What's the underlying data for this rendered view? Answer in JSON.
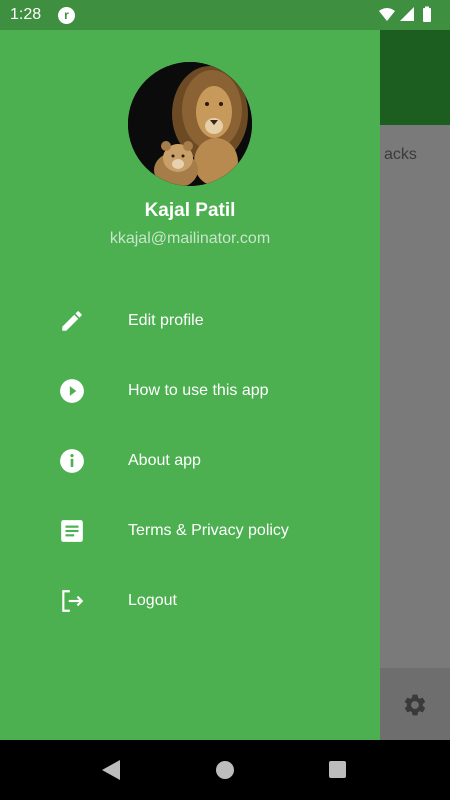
{
  "status_bar": {
    "time": "1:28",
    "app_icon_glyph": "r"
  },
  "background_app": {
    "card_text_fragment": "acks",
    "settings_icon": "gear-icon"
  },
  "profile": {
    "name": "Kajal Patil",
    "email": "kkajal@mailinator.com"
  },
  "menu": {
    "items": [
      {
        "label": "Edit profile",
        "icon": "pencil-icon"
      },
      {
        "label": "How to use this app",
        "icon": "play-circle-icon"
      },
      {
        "label": "About app",
        "icon": "info-icon"
      },
      {
        "label": "Terms & Privacy policy",
        "icon": "document-icon"
      },
      {
        "label": "Logout",
        "icon": "logout-icon"
      }
    ]
  },
  "colors": {
    "drawer": "#4caf50",
    "status_bar": "#3e8f40",
    "email_text": "#c8e6c9"
  }
}
